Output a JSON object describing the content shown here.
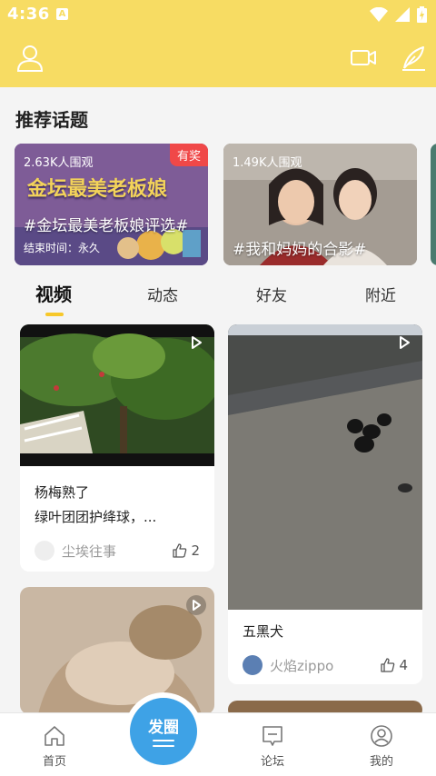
{
  "status_bar": {
    "time": "4:36",
    "notif_letter": "A"
  },
  "header": {
    "user_icon": "user-icon",
    "video_icon": "video-icon",
    "pen_icon": "pen-icon"
  },
  "section_title": "推荐话题",
  "topics": [
    {
      "count": "2.63K人围观",
      "name": "#金坛最美老板娘评选#",
      "badge": "有奖",
      "end_time": "结束时间：永久",
      "banner_text": "金坛最美老板娘"
    },
    {
      "count": "1.49K人围观",
      "name": "#我和妈妈的合影#"
    }
  ],
  "tabs": [
    {
      "label": "视频",
      "active": true
    },
    {
      "label": "动态",
      "active": false
    },
    {
      "label": "好友",
      "active": false
    },
    {
      "label": "附近",
      "active": false
    }
  ],
  "feed": {
    "card1": {
      "title_line1": "杨梅熟了",
      "title_line2": "绿叶团团护绛球，...",
      "author": "尘埃往事",
      "likes": "2"
    },
    "card2": {
      "title": "五黑犬",
      "author": "火焰zippo",
      "likes": "4"
    }
  },
  "bottom_nav": {
    "home": "首页",
    "post": "发圈",
    "forum": "论坛",
    "mine": "我的"
  },
  "colors": {
    "accent_yellow": "#f7dc63",
    "post_blue": "#3ea2e6",
    "badge_red": "#f04848"
  }
}
